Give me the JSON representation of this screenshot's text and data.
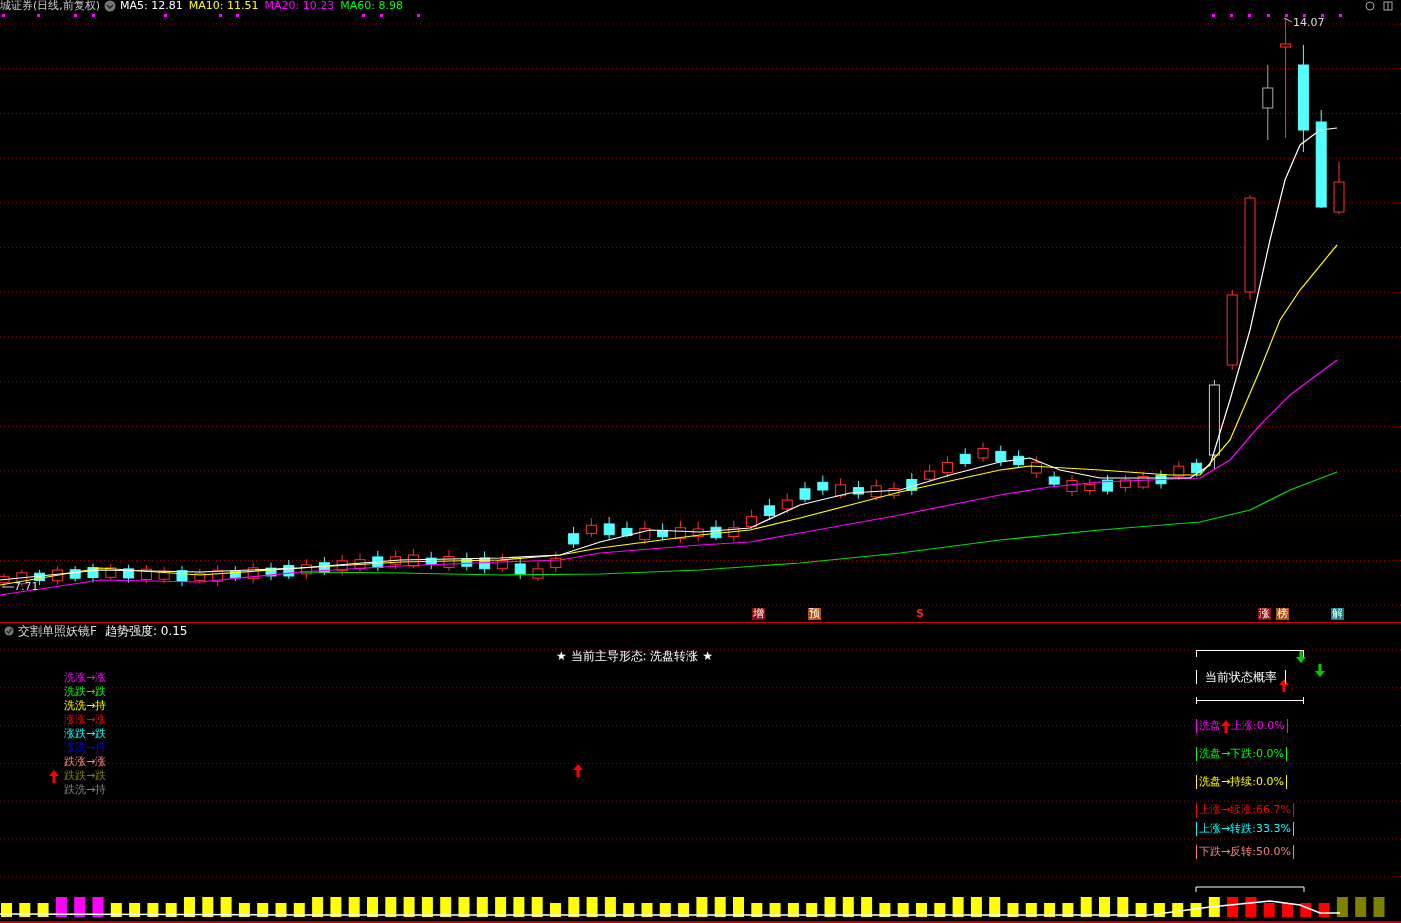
{
  "header": {
    "title": "城证券(日线,前复权)",
    "averages": [
      {
        "label": "MA5: 12.81",
        "color": "#ffffff"
      },
      {
        "label": "MA10: 11.51",
        "color": "#ffff00"
      },
      {
        "label": "MA20: 10.23",
        "color": "#ff00ff"
      },
      {
        "label": "MA60: 8.98",
        "color": "#00ff00"
      }
    ]
  },
  "price_chart": {
    "high_label": "14.07",
    "low_label": "7.71",
    "markers": [
      {
        "text": "增",
        "kind": "badge",
        "color": "#8b1010"
      },
      {
        "text": "预",
        "kind": "badge",
        "color": "#b05010"
      },
      {
        "text": "S",
        "kind": "plain",
        "color": "#ff2020"
      },
      {
        "text": "涨",
        "kind": "badge",
        "color": "#8b1010"
      },
      {
        "text": "榜",
        "kind": "badge",
        "color": "#b05010"
      },
      {
        "text": "解",
        "kind": "badge",
        "color": "#108080"
      }
    ]
  },
  "indicator": {
    "title": "交割单照妖镜F",
    "strength": "趋势强度: 0.15",
    "headline": "★ 当前主导形态: 洗盘转涨 ★",
    "legend": [
      {
        "text": "洗涨→涨",
        "color": "#ff00ff"
      },
      {
        "text": "洗跌→跌",
        "color": "#00ff00"
      },
      {
        "text": "洗洗→持",
        "color": "#ffff00"
      },
      {
        "text": "涨涨→涨",
        "color": "#ff0000"
      },
      {
        "text": "涨跌→跌",
        "color": "#00ffff"
      },
      {
        "text": "涨洗→持",
        "color": "#0000ff"
      },
      {
        "text": "跌涨→涨",
        "color": "#ff8080"
      },
      {
        "text": "跌跌→跌",
        "color": "#808000"
      },
      {
        "text": "跌洗→持",
        "color": "#808080"
      }
    ],
    "panel": {
      "title": "当前状态概率",
      "rows": [
        {
          "kind": "arrow",
          "before": "洗盘",
          "after": "上涨:0.0%",
          "color": "#ff00ff"
        },
        {
          "kind": "text",
          "text": "洗盘→下跌:0.0%",
          "color": "#00ff00"
        },
        {
          "kind": "text",
          "text": "洗盘→持续:0.0%",
          "color": "#ffff00"
        },
        {
          "kind": "text",
          "text": "上涨→续涨:66.7%",
          "color": "#ff0000"
        },
        {
          "kind": "text",
          "text": "上涨→转跌:33.3%",
          "color": "#00ffff"
        },
        {
          "kind": "text",
          "text": "下跌→反转:50.0%",
          "color": "#f08080"
        }
      ]
    }
  }
}
